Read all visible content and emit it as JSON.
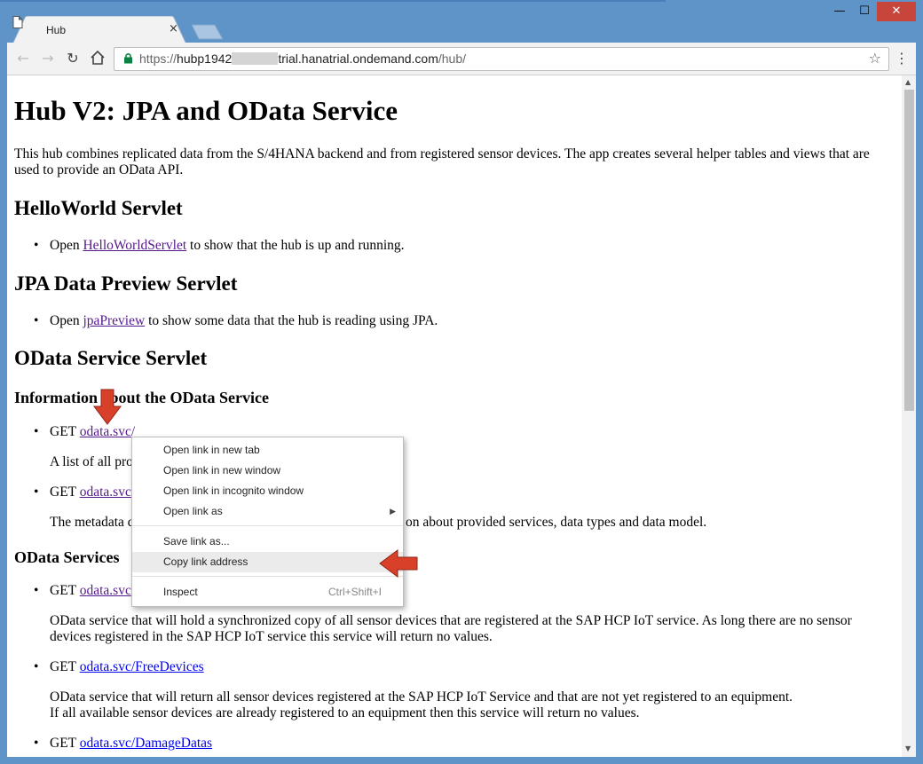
{
  "browser": {
    "tab_title": "Hub",
    "tab_close": "×",
    "url_scheme": "https://",
    "url_host_start": "hubp1942",
    "url_host_end": "trial.hanatrial.ondemand.com",
    "url_path": "/hub/",
    "win_minimize": "—",
    "win_maximize": "☐",
    "win_close": "✕"
  },
  "page": {
    "title": "Hub V2: JPA and OData Service",
    "intro": "This hub combines replicated data from the S/4HANA backend and from registered sensor devices. The app creates several helper tables and views that are used to provide an OData API.",
    "hello": {
      "heading": "HelloWorld Servlet",
      "prefix": "Open ",
      "link": "HelloWorldServlet",
      "suffix": " to show that the hub is up and running."
    },
    "jpa": {
      "heading": "JPA Data Preview Servlet",
      "prefix": "Open ",
      "link": "jpaPreview",
      "suffix": " to show some data that the hub is reading using JPA."
    },
    "odata": {
      "heading": "OData Service Servlet",
      "info_heading": "Information about the OData Service",
      "get1_prefix": "GET ",
      "get1_link": "odata.svc/",
      "get1_desc": "A list of all pro",
      "get2_prefix": "GET ",
      "get2_link": "odata.svc",
      "get2_desc_start": "The metadata d",
      "get2_desc_end": "on about provided services, data types and data model.",
      "services_heading": "OData Services",
      "get3_prefix": "GET ",
      "get3_link": "odata.svc",
      "get3_desc": "OData service that will hold a synchronized copy of all sensor devices that are registered at the SAP HCP IoT service. As long there are no sensor devices registered in the SAP HCP IoT service this service will return no values.",
      "get4_prefix": "GET ",
      "get4_link": "odata.svc/FreeDevices",
      "get4_desc1": "OData service that will return all sensor devices registered at the SAP HCP IoT Service and that are not yet registered to an equipment.",
      "get4_desc2": "If all available sensor devices are already registered to an equipment then this service will return no values.",
      "get5_prefix": "GET ",
      "get5_link": "odata.svc/DamageDatas"
    }
  },
  "context_menu": {
    "items": [
      {
        "label": "Open link in new tab"
      },
      {
        "label": "Open link in new window"
      },
      {
        "label": "Open link in incognito window"
      },
      {
        "label": "Open link as"
      },
      {
        "label": "Save link as..."
      },
      {
        "label": "Copy link address"
      },
      {
        "label": "Inspect",
        "shortcut": "Ctrl+Shift+I"
      }
    ]
  },
  "colors": {
    "window_frame": "#5f94c9",
    "visited_link": "#551a8b",
    "link": "#0000ee",
    "annotation_arrow": "#d8402a"
  }
}
